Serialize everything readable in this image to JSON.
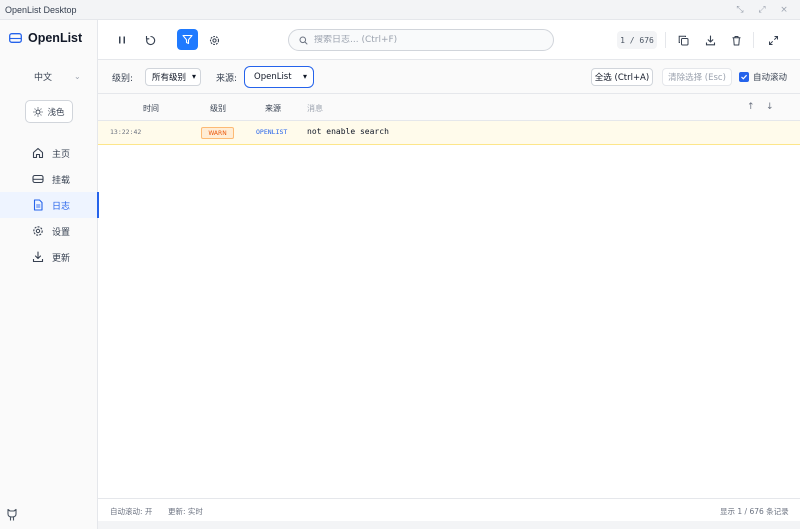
{
  "window": {
    "title": "OpenList Desktop"
  },
  "sidebar": {
    "brand": "OpenList",
    "language": "中文",
    "theme_label": "浅色",
    "items": [
      {
        "label": "主页",
        "icon": "home-icon"
      },
      {
        "label": "挂载",
        "icon": "drive-icon"
      },
      {
        "label": "日志",
        "icon": "document-icon",
        "active": true
      },
      {
        "label": "设置",
        "icon": "gear-icon"
      },
      {
        "label": "更新",
        "icon": "download-icon"
      }
    ]
  },
  "toolbar": {
    "search_placeholder": "搜索日志... (Ctrl+F)",
    "counter": "1 / 676"
  },
  "filters": {
    "level_label": "级别:",
    "level_value": "所有级别",
    "source_label": "来源:",
    "source_value": "OpenList",
    "select_all": "全选 (Ctrl+A)",
    "clear_selection": "清除选择 (Esc)",
    "auto_scroll": "自动滚动"
  },
  "table": {
    "headers": {
      "time": "时间",
      "level": "级别",
      "source": "来源",
      "message": "消息"
    },
    "rows": [
      {
        "time": "13:22:42",
        "level": "WARN",
        "source": "OPENLIST",
        "message": "not enable search"
      }
    ]
  },
  "statusbar": {
    "auto_scroll": "自动滚动: 开",
    "update": "更新: 实时",
    "display": "显示 1 / 676 条记录"
  },
  "colors": {
    "accent": "#1f7aff",
    "warn_bg": "#fffbeb",
    "warn": "#ea580c"
  }
}
